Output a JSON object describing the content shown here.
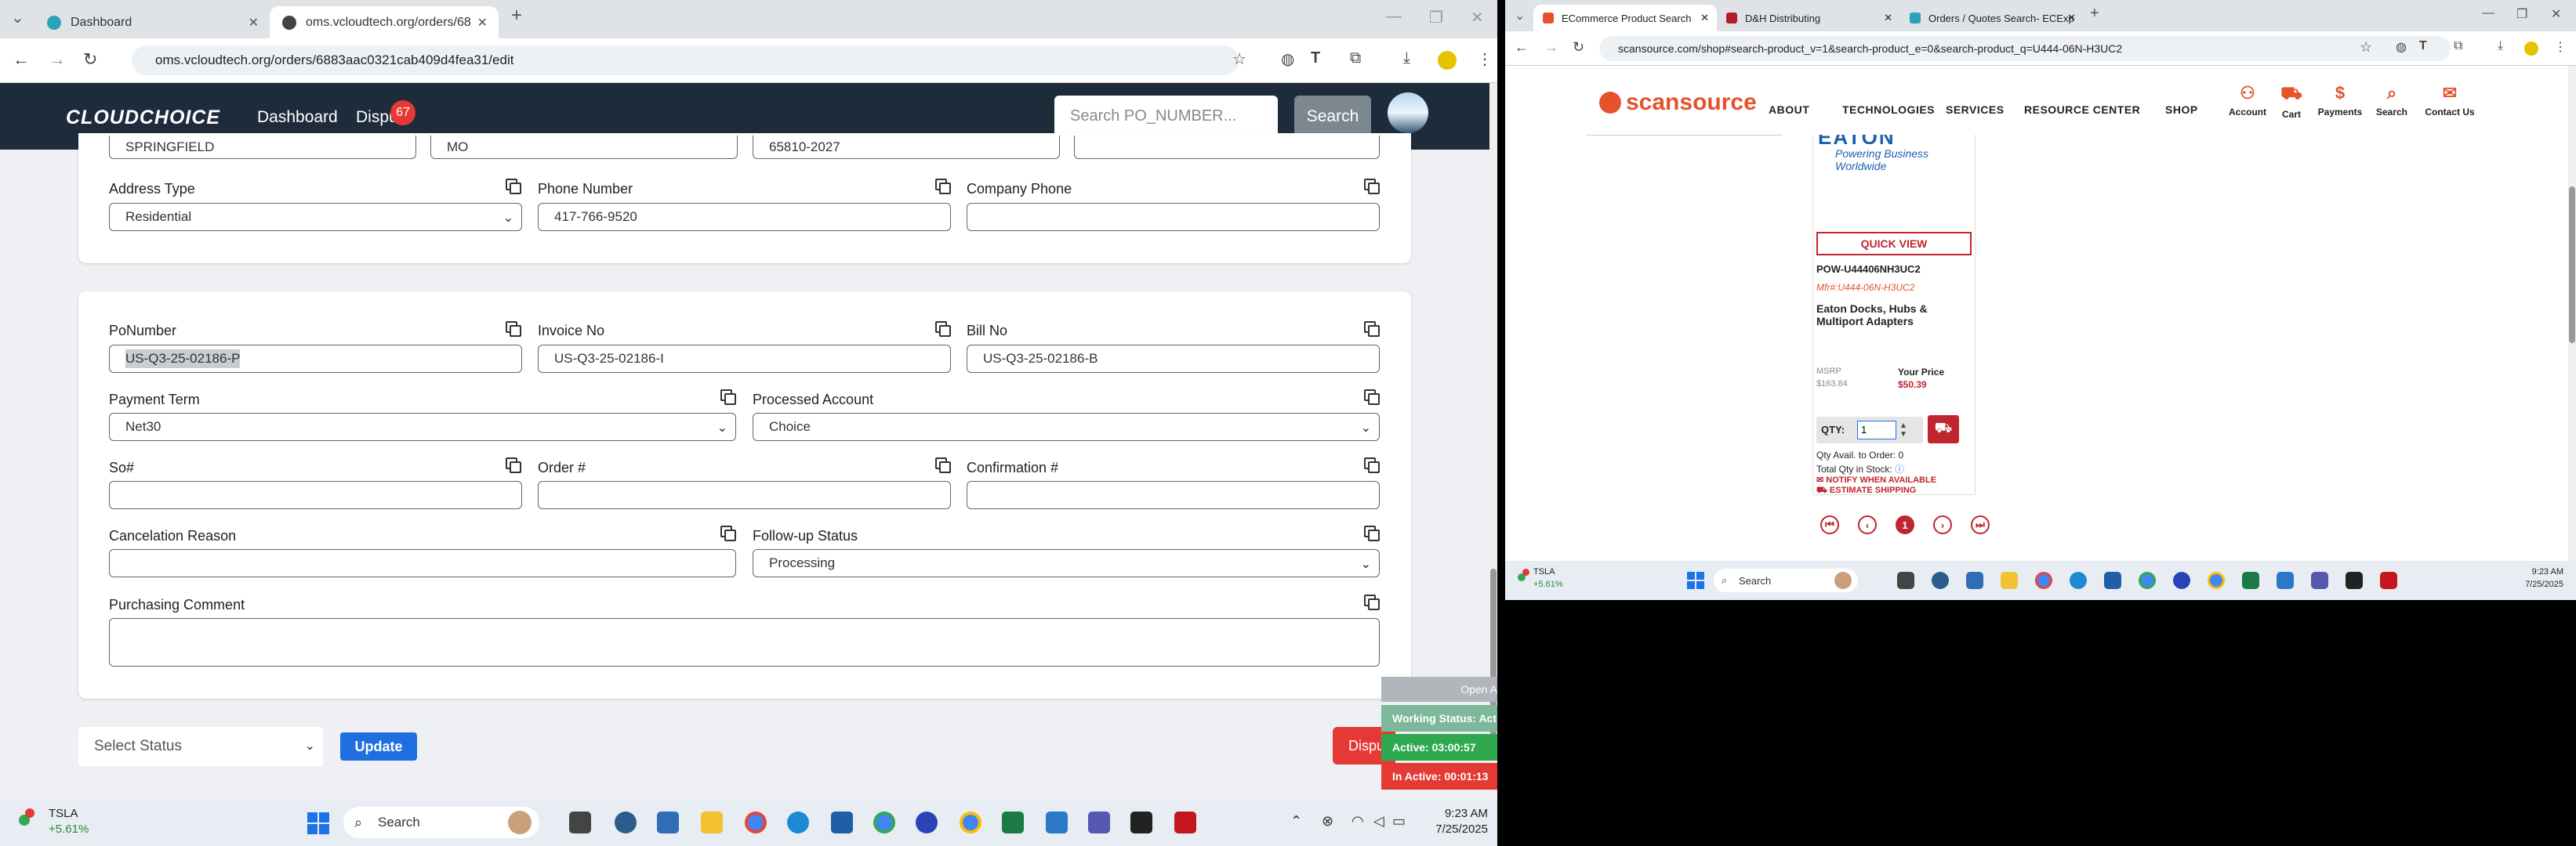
{
  "left_browser": {
    "tabs": [
      {
        "label": "Dashboard"
      },
      {
        "label": "oms.vcloudtech.org/orders/68"
      }
    ],
    "url": "oms.vcloudtech.org/orders/6883aac0321cab409d4fea31/edit"
  },
  "app": {
    "logo": "CLOUDCHOICE",
    "nav": {
      "dashboard": "Dashboard",
      "disputes": "Dispu",
      "disputes_badge": "67"
    },
    "search_placeholder": "Search PO_NUMBER...",
    "search_button": "Search"
  },
  "address_card": {
    "row_top": {
      "city": "SPRINGFIELD",
      "state": "MO",
      "zip": "65810-2027",
      "extra": ""
    },
    "address_type_label": "Address Type",
    "address_type_value": "Residential",
    "phone_label": "Phone Number",
    "phone_value": "417-766-9520",
    "company_phone_label": "Company Phone",
    "company_phone_value": ""
  },
  "order_card": {
    "po_label": "PoNumber",
    "po_value": "US-Q3-25-02186-P",
    "invoice_label": "Invoice No",
    "invoice_value": "US-Q3-25-02186-I",
    "bill_label": "Bill No",
    "bill_value": "US-Q3-25-02186-B",
    "payment_term_label": "Payment Term",
    "payment_term_value": "Net30",
    "processed_account_label": "Processed Account",
    "processed_account_value": "Choice",
    "so_label": "So#",
    "order_label": "Order #",
    "confirmation_label": "Confirmation #",
    "cancel_label": "Cancelation Reason",
    "followup_label": "Follow-up Status",
    "followup_value": "Processing",
    "comment_label": "Purchasing Comment"
  },
  "actions": {
    "status_placeholder": "Select Status",
    "update": "Update",
    "dispute": "Dispu"
  },
  "timers": {
    "open": "Open A",
    "working": "Working Status: Act",
    "active": "Active: 03:00:57",
    "inactive": "In Active: 00:01:13"
  },
  "taskbar_left": {
    "ticker": "TSLA",
    "change": "+5.61%",
    "search": "Search",
    "time": "9:23 AM",
    "date": "7/25/2025"
  },
  "right_browser": {
    "tabs": [
      {
        "label": "ECommerce Product Search"
      },
      {
        "label": "D&H Distributing"
      },
      {
        "label": "Orders / Quotes Search- ECExp"
      }
    ],
    "url": "scansource.com/shop#search-product_v=1&search-product_e=0&search-product_q=U444-06N-H3UC2"
  },
  "scansource": {
    "logo": "scansource",
    "nav": [
      "ABOUT",
      "TECHNOLOGIES",
      "SERVICES",
      "RESOURCE CENTER",
      "SHOP"
    ],
    "icons": [
      {
        "label": "Account",
        "icon": "person-icon"
      },
      {
        "label": "Cart",
        "icon": "cart-icon"
      },
      {
        "label": "Payments",
        "icon": "dollar-icon"
      },
      {
        "label": "Search",
        "icon": "search-icon"
      },
      {
        "label": "Contact Us",
        "icon": "chat-icon"
      }
    ],
    "brand_tagline": "Powering Business Worldwide",
    "quick_view": "QUICK VIEW",
    "sku": "POW-U44406NH3UC2",
    "mfr": "Mfr#:U444-06N-H3UC2",
    "product_name": "Eaton Docks, Hubs & Multiport Adapters",
    "msrp_label": "MSRP",
    "msrp_value": "$163.84",
    "price_label": "Your Price",
    "price_value": "$50.39",
    "qty_label": "QTY:",
    "qty_value": "1",
    "avail": "Qty Avail. to Order: 0",
    "total_stock": "Total Qty in Stock:",
    "notify": "NOTIFY WHEN AVAILABLE",
    "estimate": "ESTIMATE SHIPPING",
    "page_current": "1"
  },
  "taskbar_right": {
    "ticker": "TSLA",
    "change": "+5.61%",
    "search": "Search",
    "time": "9:23 AM",
    "date": "7/25/2025"
  }
}
